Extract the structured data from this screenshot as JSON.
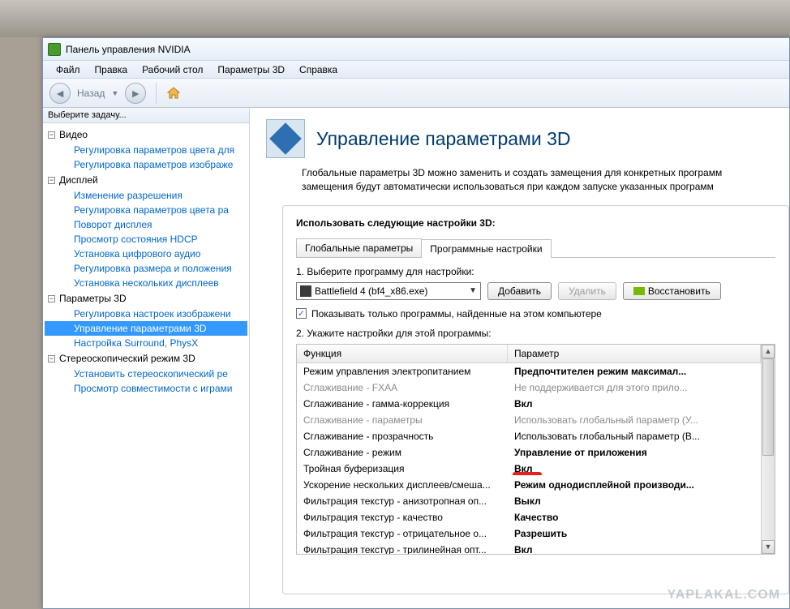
{
  "window": {
    "title": "Панель управления NVIDIA"
  },
  "menu": {
    "file": "Файл",
    "edit": "Правка",
    "desktop": "Рабочий стол",
    "params3d": "Параметры 3D",
    "help": "Справка"
  },
  "toolbar": {
    "back": "Назад"
  },
  "taskpane": {
    "header": "Выберите задачу...",
    "video": "Видео",
    "video_items": [
      "Регулировка параметров цвета для",
      "Регулировка параметров изображе"
    ],
    "display": "Дисплей",
    "display_items": [
      "Изменение разрешения",
      "Регулировка параметров цвета ра",
      "Поворот дисплея",
      "Просмотр состояния HDCP",
      "Установка цифрового аудио",
      "Регулировка размера и положения",
      "Установка нескольких дисплеев"
    ],
    "p3d": "Параметры 3D",
    "p3d_items": [
      "Регулировка настроек изображени",
      "Управление параметрами 3D",
      "Настройка Surround, PhysX"
    ],
    "stereo": "Стереоскопический режим 3D",
    "stereo_items": [
      "Установить стереоскопический ре",
      "Просмотр совместимости с играми"
    ]
  },
  "page": {
    "title": "Управление параметрами 3D",
    "desc": "Глобальные параметры 3D можно заменить и создать замещения для конкретных программ замещения будут автоматически использоваться при каждом запуске указанных программ"
  },
  "panel": {
    "heading": "Использовать следующие настройки 3D:",
    "tab_global": "Глобальные параметры",
    "tab_program": "Программные настройки",
    "step1": "1. Выберите программу для настройки:",
    "combo_value": "Battlefield 4 (bf4_x86.exe)",
    "btn_add": "Добавить",
    "btn_remove": "Удалить",
    "btn_restore": "Восстановить",
    "chk": "Показывать только программы, найденные на этом компьютере",
    "step2": "2. Укажите настройки для этой программы:",
    "col_func": "Функция",
    "col_param": "Параметр",
    "rows": [
      {
        "f": "Режим управления электропитанием",
        "p": "Предпочтителен режим максимал...",
        "b": true
      },
      {
        "f": "Сглаживание - FXAA",
        "p": "Не поддерживается для этого прило...",
        "d": true
      },
      {
        "f": "Сглаживание - гамма-коррекция",
        "p": "Вкл",
        "b": true
      },
      {
        "f": "Сглаживание - параметры",
        "p": "Использовать глобальный параметр (У...",
        "d": true
      },
      {
        "f": "Сглаживание - прозрачность",
        "p": "Использовать глобальный параметр (В..."
      },
      {
        "f": "Сглаживание - режим",
        "p": "Управление от приложения",
        "b": true
      },
      {
        "f": "Тройная буферизация",
        "p": "Вкл",
        "b": true,
        "mark": true
      },
      {
        "f": "Ускорение нескольких дисплеев/смеша...",
        "p": "Режим однодисплейной производи...",
        "b": true
      },
      {
        "f": "Фильтрация текстур - анизотропная оп...",
        "p": "Выкл",
        "b": true
      },
      {
        "f": "Фильтрация текстур - качество",
        "p": "Качество",
        "b": true
      },
      {
        "f": "Фильтрация текстур - отрицательное о...",
        "p": "Разрешить",
        "b": true
      },
      {
        "f": "Фильтрация текстур - трилинейная опт...",
        "p": "Вкл",
        "b": true
      }
    ]
  },
  "watermark": "YAPLAKAL.COM"
}
